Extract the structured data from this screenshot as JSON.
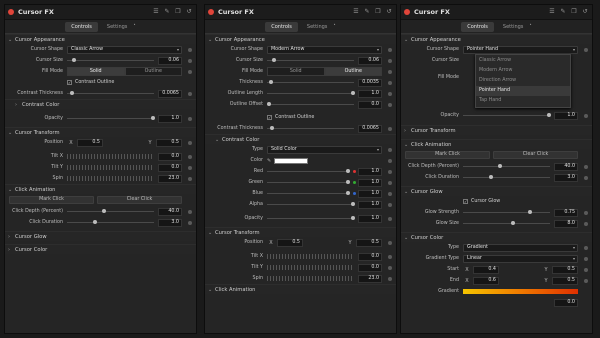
{
  "window_title": "Cursor FX",
  "tabs": {
    "controls": "Controls",
    "settings": "Settings"
  },
  "accent": "#e0453a",
  "p1": {
    "appearance": "Cursor Appearance",
    "shape_label": "Cursor Shape",
    "shape_value": "Classic Arrow",
    "size_label": "Cursor Size",
    "size_value": "0.06",
    "fill_label": "Fill Mode",
    "fill_solid": "Solid",
    "fill_outline": "Outline",
    "contrast_outline": "Contrast Outline",
    "thickness_label": "Contrast Thickness",
    "thickness_value": "0.0065",
    "contrast_color": "Contrast Color",
    "opacity_label": "Opacity",
    "opacity_value": "1.0",
    "transform": "Cursor Transform",
    "position_label": "Position",
    "pos_x_axis": "X",
    "pos_x": "0.5",
    "pos_y_axis": "Y",
    "pos_y": "0.5",
    "tiltx_label": "Tilt X",
    "tiltx_value": "0.0",
    "tilty_label": "Tilt Y",
    "tilty_value": "0.0",
    "spin_label": "Spin",
    "spin_value": "23.0",
    "click_anim": "Click Animation",
    "mark_click": "Mark Click",
    "clear_click": "Clear Click",
    "depth_label": "Click Depth (Percent)",
    "depth_value": "40.0",
    "duration_label": "Click Duration",
    "duration_value": "3.0",
    "glow": "Cursor Glow",
    "color": "Cursor Color"
  },
  "p2": {
    "appearance": "Cursor Appearance",
    "shape_label": "Cursor Shape",
    "shape_value": "Modern Arrow",
    "size_label": "Cursor Size",
    "size_value": "0.06",
    "fill_label": "Fill Mode",
    "fill_solid": "Solid",
    "fill_outline": "Outline",
    "thickness_label": "Thickness",
    "thickness_value": "0.0035",
    "outline_length_label": "Outline Length",
    "outline_length_value": "1.0",
    "outline_offset_label": "Outline Offset",
    "outline_offset_value": "0.0",
    "contrast_outline": "Contrast Outline",
    "cthick_label": "Contrast Thickness",
    "cthick_value": "0.0065",
    "contrast_color": "Contrast Color",
    "type_label": "Type",
    "type_value": "Solid Color",
    "color_label": "Color",
    "red_label": "Red",
    "red_value": "1.0",
    "green_label": "Green",
    "green_value": "1.0",
    "blue_label": "Blue",
    "blue_value": "1.0",
    "alpha_label": "Alpha",
    "alpha_value": "1.0",
    "opacity_label": "Opacity",
    "opacity_value": "1.0",
    "transform": "Cursor Transform",
    "position_label": "Position",
    "pos_x_axis": "X",
    "pos_x": "0.5",
    "pos_y_axis": "Y",
    "pos_y": "0.5",
    "tiltx_label": "Tilt X",
    "tiltx_value": "0.0",
    "tilty_label": "Tilt Y",
    "tilty_value": "0.0",
    "spin_label": "Spin",
    "spin_value": "23.0",
    "click_anim": "Click Animation"
  },
  "p3": {
    "appearance": "Cursor Appearance",
    "shape_label": "Cursor Shape",
    "shape_value": "Pointer Hand",
    "size_label": "Cursor Size",
    "fill_label": "Fill Mode",
    "opacity_label": "Opacity",
    "opacity_value": "1.0",
    "menu": [
      "Classic Arrow",
      "Modern Arrow",
      "Direction Arrow",
      "Pointer Hand",
      "Tap Hand"
    ],
    "transform": "Cursor Transform",
    "click_anim": "Click Animation",
    "mark_click": "Mark Click",
    "clear_click": "Clear Click",
    "depth_label": "Click Depth (Percent)",
    "depth_value": "40.0",
    "duration_label": "Click Duration",
    "duration_value": "3.0",
    "glow": "Cursor Glow",
    "glow_check": "Cursor Glow",
    "gstrength_label": "Glow Strength",
    "gstrength_value": "0.75",
    "gsize_label": "Glow Size",
    "gsize_value": "8.0",
    "color": "Cursor Color",
    "type_label": "Type",
    "type_value": "Gradient",
    "gtype_label": "Gradient Type",
    "gtype_value": "Linear",
    "start_label": "Start",
    "start_x_axis": "X",
    "start_x": "0.4",
    "start_y_axis": "Y",
    "start_y": "0.5",
    "end_label": "End",
    "end_x_axis": "X",
    "end_x": "0.6",
    "end_y_axis": "Y",
    "end_y": "0.5",
    "gradient_label": "Gradient",
    "last_value": "0.0"
  }
}
